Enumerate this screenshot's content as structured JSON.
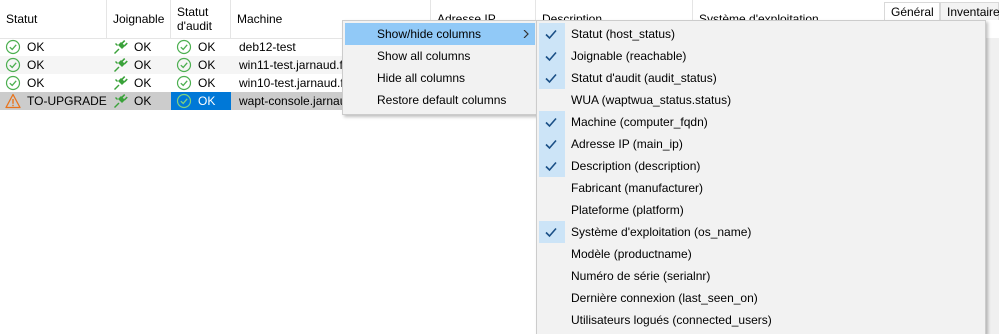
{
  "grid": {
    "columns": {
      "statut": "Statut",
      "joignable": "Joignable",
      "audit_line1": "Statut",
      "audit_line2": "d'audit",
      "machine": "Machine",
      "ip": "Adresse IP",
      "description": "Description",
      "os": "Système d'exploitation"
    },
    "rows": [
      {
        "statut": "OK",
        "statut_icon": "check-circle-icon",
        "joignable": "OK",
        "audit": "OK",
        "machine": "deb12-test"
      },
      {
        "statut": "OK",
        "statut_icon": "check-circle-icon",
        "joignable": "OK",
        "audit": "OK",
        "machine": "win11-test.jarnaud.f"
      },
      {
        "statut": "OK",
        "statut_icon": "check-circle-icon",
        "joignable": "OK",
        "audit": "OK",
        "machine": "win10-test.jarnaud.f"
      },
      {
        "statut": "TO-UPGRADE",
        "statut_icon": "warning-icon",
        "joignable": "OK",
        "audit": "OK",
        "machine": "wapt-console.jarnau"
      }
    ]
  },
  "right_panel": {
    "tabs": [
      "Général",
      "Inventaire"
    ]
  },
  "context_menu": {
    "items": [
      "Show/hide columns",
      "Show all columns",
      "Hide all columns",
      "Restore default columns"
    ]
  },
  "submenu": {
    "items": [
      {
        "label": "Statut (host_status)",
        "checked": true
      },
      {
        "label": "Joignable (reachable)",
        "checked": true
      },
      {
        "label": "Statut d'audit (audit_status)",
        "checked": true
      },
      {
        "label": "WUA (waptwua_status.status)",
        "checked": false
      },
      {
        "label": "Machine (computer_fqdn)",
        "checked": true
      },
      {
        "label": "Adresse IP (main_ip)",
        "checked": true
      },
      {
        "label": "Description (description)",
        "checked": true
      },
      {
        "label": "Fabricant (manufacturer)",
        "checked": false
      },
      {
        "label": "Plateforme (platform)",
        "checked": false
      },
      {
        "label": "Système d'exploitation (os_name)",
        "checked": true
      },
      {
        "label": "Modèle (productname)",
        "checked": false
      },
      {
        "label": "Numéro de série (serialnr)",
        "checked": false
      },
      {
        "label": "Dernière connexion (last_seen_on)",
        "checked": false
      },
      {
        "label": "Utilisateurs logués (connected_users)",
        "checked": false
      }
    ]
  },
  "colors": {
    "ok_green": "#4caf50",
    "plug_green": "#3aa23a",
    "warning_orange": "#e8731c",
    "selected_blue": "#0078d7",
    "selected_row_grey": "#cccccc",
    "menu_highlight": "#91c9f7",
    "check_bg": "#cce4f7"
  }
}
